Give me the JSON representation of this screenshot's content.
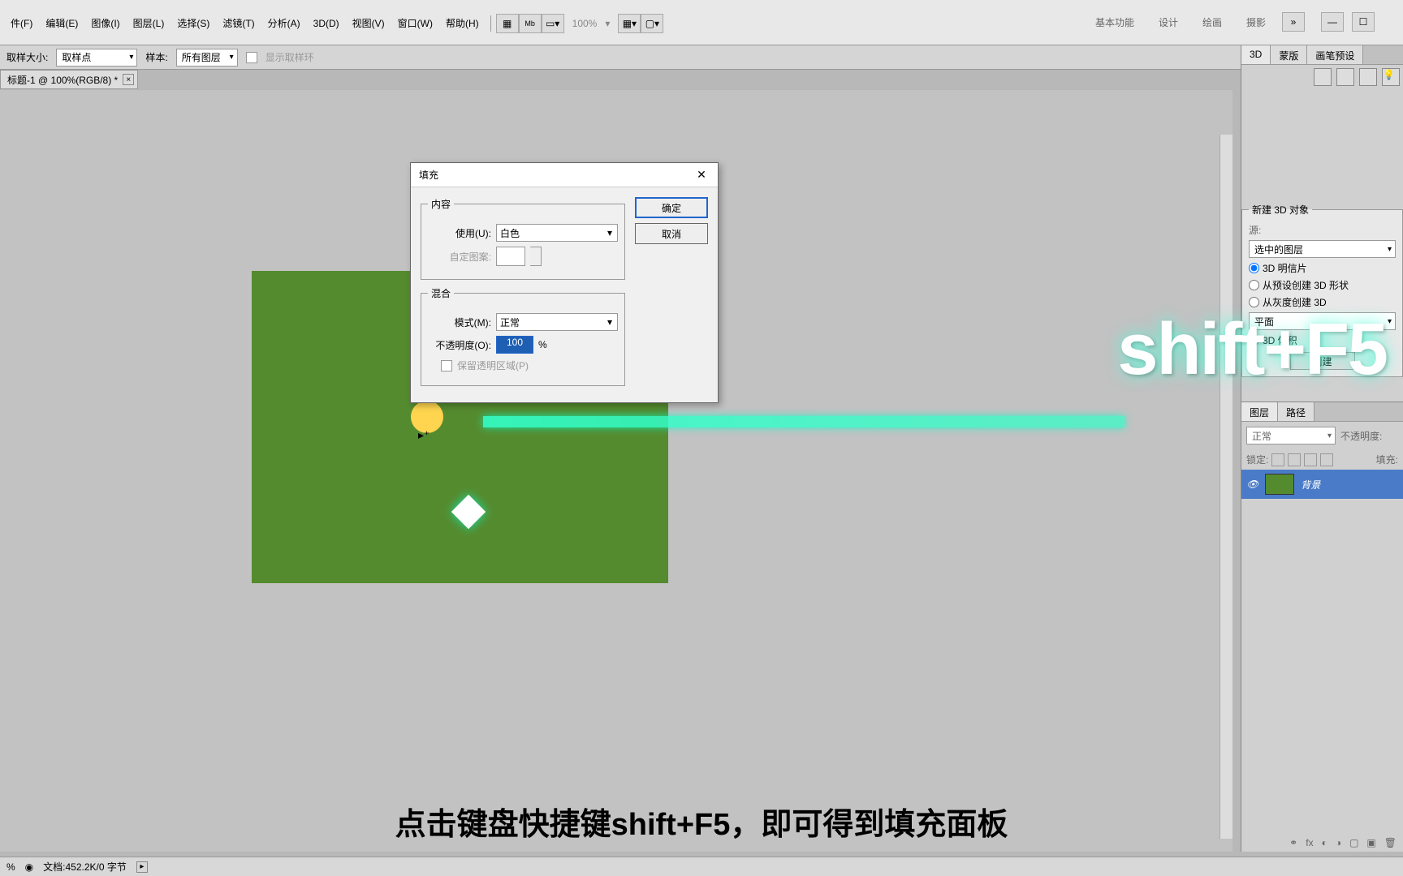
{
  "menu": {
    "items": [
      "件(F)",
      "编辑(E)",
      "图像(I)",
      "图层(L)",
      "选择(S)",
      "滤镜(T)",
      "分析(A)",
      "3D(D)",
      "视图(V)",
      "窗口(W)",
      "帮助(H)"
    ],
    "zoom": "100%"
  },
  "workspaces": [
    "基本功能",
    "设计",
    "绘画",
    "摄影"
  ],
  "optbar": {
    "label1": "取样大小:",
    "val1": "取样点",
    "label2": "样本:",
    "val2": "所有图层",
    "chk": "显示取样环"
  },
  "doc": {
    "tab": "标题-1 @ 100%(RGB/8) *"
  },
  "dialog": {
    "title": "填充",
    "ok": "确定",
    "cancel": "取消",
    "grp1": "内容",
    "use_label": "使用(U):",
    "use_val": "白色",
    "pattern_label": "自定图案:",
    "grp2": "混合",
    "mode_label": "模式(M):",
    "mode_val": "正常",
    "opacity_label": "不透明度(O):",
    "opacity_val": "100",
    "pct": "%",
    "preserve": "保留透明区域(P)"
  },
  "panels": {
    "tabs": [
      "3D",
      "蒙版",
      "画笔预设"
    ],
    "new3d": "新建 3D 对象",
    "src": "源:",
    "src_val": "选中的图层",
    "radios": [
      "3D 明信片",
      "从预设创建 3D 形状",
      "从灰度创建 3D",
      "平面",
      "3D 体积"
    ],
    "create": "创建",
    "layers_tab": "图层",
    "paths_tab": "路径",
    "blend": "正常",
    "opacity_lbl": "不透明度:",
    "lock": "锁定:",
    "fill_lbl": "填充:",
    "layer_name": "背景"
  },
  "overlay": "shift+F5",
  "caption": "点击键盘快捷键shift+F5，即可得到填充面板",
  "status": {
    "zoom": "%",
    "doc": "文档:452.2K/0 字节"
  }
}
